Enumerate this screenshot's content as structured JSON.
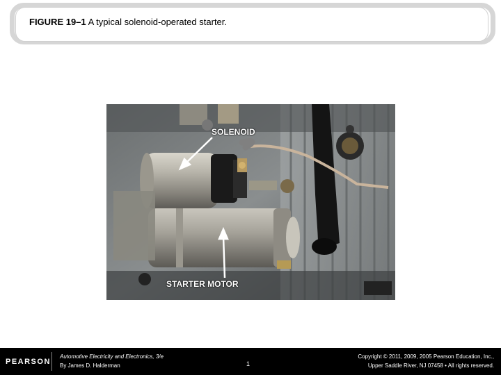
{
  "title": {
    "figure_number": "FIGURE 19–1",
    "caption": "A typical solenoid-operated starter."
  },
  "photo": {
    "label_solenoid": "SOLENOID",
    "label_starter_motor": "STARTER MOTOR"
  },
  "footer": {
    "logo": "PEARSON",
    "book_title": "Automotive Electricity and Electronics, 3/e",
    "author": "By James D. Halderman",
    "page_number": "1",
    "copyright_line1": "Copyright © 2011, 2009, 2005 Pearson Education, Inc.,",
    "copyright_line2": "Upper Saddle River, NJ 07458 • All rights reserved."
  }
}
